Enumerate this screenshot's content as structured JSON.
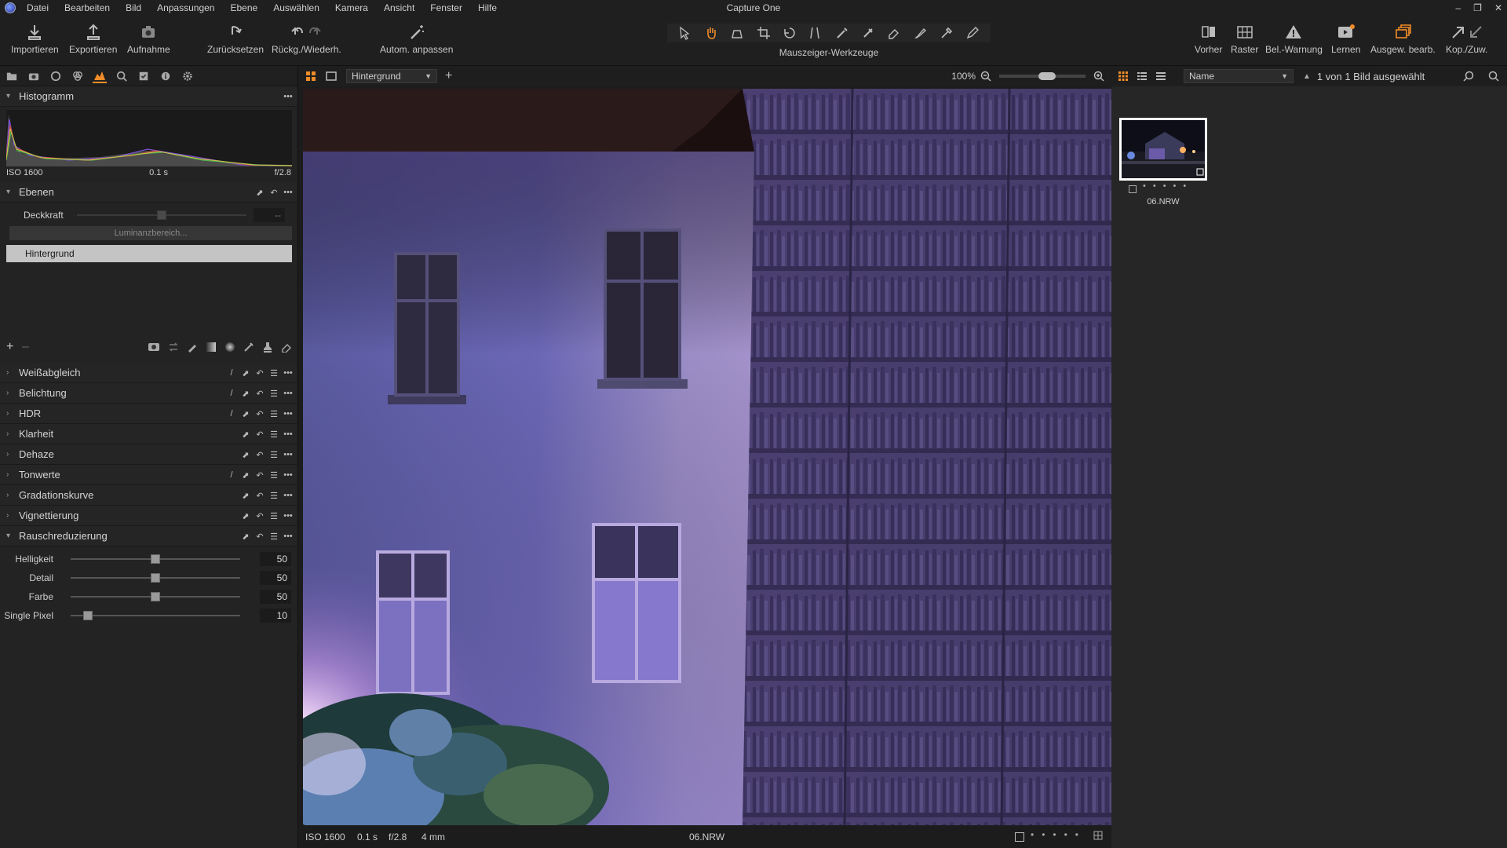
{
  "app": {
    "title": "Capture One",
    "menu": [
      "Datei",
      "Bearbeiten",
      "Bild",
      "Anpassungen",
      "Ebene",
      "Auswählen",
      "Kamera",
      "Ansicht",
      "Fenster",
      "Hilfe"
    ]
  },
  "toolbar": {
    "left": [
      {
        "label": "Importieren",
        "icon": "import-icon"
      },
      {
        "label": "Exportieren",
        "icon": "export-icon"
      },
      {
        "label": "Aufnahme",
        "icon": "camera-icon"
      },
      {
        "label": "Zurücksetzen",
        "icon": "reset-icon"
      },
      {
        "label": "Rückg./Wiederh.",
        "icon": "undo-redo-icon"
      },
      {
        "label": "Autom. anpassen",
        "icon": "magic-wand-icon"
      }
    ],
    "cursor_tools_label": "Mauszeiger-Werkzeuge",
    "right": [
      {
        "label": "Vorher",
        "icon": "before-after-icon"
      },
      {
        "label": "Raster",
        "icon": "grid-icon"
      },
      {
        "label": "Bel.-Warnung",
        "icon": "warning-icon"
      },
      {
        "label": "Lernen",
        "icon": "play-icon"
      },
      {
        "label": "Ausgew. bearb.",
        "icon": "edit-selected-icon"
      },
      {
        "label": "Kop./Zuw.",
        "icon": "copy-apply-icon"
      }
    ],
    "accent_color": "#f08c28"
  },
  "histogram": {
    "title": "Histogramm",
    "iso": "ISO 1600",
    "shutter": "0.1 s",
    "aperture": "f/2.8"
  },
  "layers": {
    "title": "Ebenen",
    "opacity_label": "Deckkraft",
    "opacity_value": "--",
    "luminance_button": "Luminanzbereich...",
    "layer_name": "Hintergrund"
  },
  "tools": [
    {
      "name": "Weißabgleich",
      "expanded": false
    },
    {
      "name": "Belichtung",
      "expanded": false
    },
    {
      "name": "HDR",
      "expanded": false
    },
    {
      "name": "Klarheit",
      "expanded": false
    },
    {
      "name": "Dehaze",
      "expanded": false
    },
    {
      "name": "Tonwerte",
      "expanded": false
    },
    {
      "name": "Gradationskurve",
      "expanded": false
    },
    {
      "name": "Vignettierung",
      "expanded": false
    },
    {
      "name": "Rauschreduzierung",
      "expanded": true
    }
  ],
  "noise_reduction": {
    "sliders": [
      {
        "label": "Helligkeit",
        "value": "50",
        "fraction": 0.5
      },
      {
        "label": "Detail",
        "value": "50",
        "fraction": 0.5
      },
      {
        "label": "Farbe",
        "value": "50",
        "fraction": 0.5
      },
      {
        "label": "Single Pixel",
        "value": "10",
        "fraction": 0.1
      }
    ]
  },
  "viewer": {
    "layer_select": "Hintergrund",
    "zoom": "100%",
    "status": {
      "iso": "ISO 1600",
      "shutter": "0.1 s",
      "aperture": "f/2.8",
      "focal": "4 mm",
      "filename": "06.NRW"
    }
  },
  "browser": {
    "sort_select": "Name",
    "selection_text": "1 von 1 Bild ausgewählt",
    "thumbnail_name": "06.NRW"
  }
}
